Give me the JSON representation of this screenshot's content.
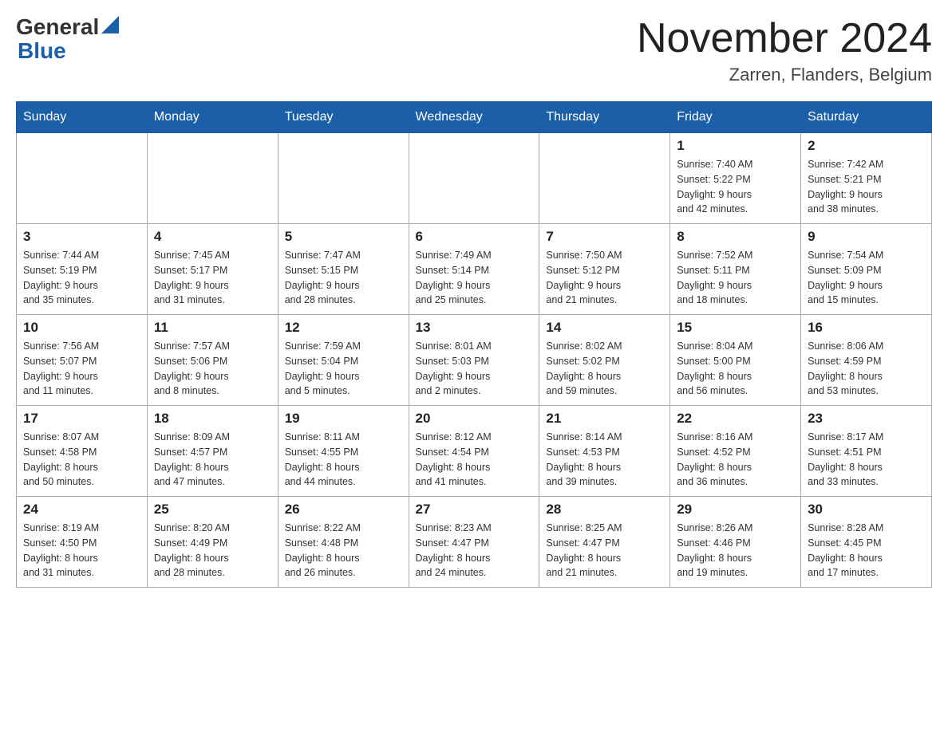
{
  "header": {
    "logo_line1": "General",
    "logo_line2": "Blue",
    "month_title": "November 2024",
    "location": "Zarren, Flanders, Belgium"
  },
  "calendar": {
    "days_of_week": [
      "Sunday",
      "Monday",
      "Tuesday",
      "Wednesday",
      "Thursday",
      "Friday",
      "Saturday"
    ],
    "weeks": [
      [
        {
          "day": "",
          "info": ""
        },
        {
          "day": "",
          "info": ""
        },
        {
          "day": "",
          "info": ""
        },
        {
          "day": "",
          "info": ""
        },
        {
          "day": "",
          "info": ""
        },
        {
          "day": "1",
          "info": "Sunrise: 7:40 AM\nSunset: 5:22 PM\nDaylight: 9 hours\nand 42 minutes."
        },
        {
          "day": "2",
          "info": "Sunrise: 7:42 AM\nSunset: 5:21 PM\nDaylight: 9 hours\nand 38 minutes."
        }
      ],
      [
        {
          "day": "3",
          "info": "Sunrise: 7:44 AM\nSunset: 5:19 PM\nDaylight: 9 hours\nand 35 minutes."
        },
        {
          "day": "4",
          "info": "Sunrise: 7:45 AM\nSunset: 5:17 PM\nDaylight: 9 hours\nand 31 minutes."
        },
        {
          "day": "5",
          "info": "Sunrise: 7:47 AM\nSunset: 5:15 PM\nDaylight: 9 hours\nand 28 minutes."
        },
        {
          "day": "6",
          "info": "Sunrise: 7:49 AM\nSunset: 5:14 PM\nDaylight: 9 hours\nand 25 minutes."
        },
        {
          "day": "7",
          "info": "Sunrise: 7:50 AM\nSunset: 5:12 PM\nDaylight: 9 hours\nand 21 minutes."
        },
        {
          "day": "8",
          "info": "Sunrise: 7:52 AM\nSunset: 5:11 PM\nDaylight: 9 hours\nand 18 minutes."
        },
        {
          "day": "9",
          "info": "Sunrise: 7:54 AM\nSunset: 5:09 PM\nDaylight: 9 hours\nand 15 minutes."
        }
      ],
      [
        {
          "day": "10",
          "info": "Sunrise: 7:56 AM\nSunset: 5:07 PM\nDaylight: 9 hours\nand 11 minutes."
        },
        {
          "day": "11",
          "info": "Sunrise: 7:57 AM\nSunset: 5:06 PM\nDaylight: 9 hours\nand 8 minutes."
        },
        {
          "day": "12",
          "info": "Sunrise: 7:59 AM\nSunset: 5:04 PM\nDaylight: 9 hours\nand 5 minutes."
        },
        {
          "day": "13",
          "info": "Sunrise: 8:01 AM\nSunset: 5:03 PM\nDaylight: 9 hours\nand 2 minutes."
        },
        {
          "day": "14",
          "info": "Sunrise: 8:02 AM\nSunset: 5:02 PM\nDaylight: 8 hours\nand 59 minutes."
        },
        {
          "day": "15",
          "info": "Sunrise: 8:04 AM\nSunset: 5:00 PM\nDaylight: 8 hours\nand 56 minutes."
        },
        {
          "day": "16",
          "info": "Sunrise: 8:06 AM\nSunset: 4:59 PM\nDaylight: 8 hours\nand 53 minutes."
        }
      ],
      [
        {
          "day": "17",
          "info": "Sunrise: 8:07 AM\nSunset: 4:58 PM\nDaylight: 8 hours\nand 50 minutes."
        },
        {
          "day": "18",
          "info": "Sunrise: 8:09 AM\nSunset: 4:57 PM\nDaylight: 8 hours\nand 47 minutes."
        },
        {
          "day": "19",
          "info": "Sunrise: 8:11 AM\nSunset: 4:55 PM\nDaylight: 8 hours\nand 44 minutes."
        },
        {
          "day": "20",
          "info": "Sunrise: 8:12 AM\nSunset: 4:54 PM\nDaylight: 8 hours\nand 41 minutes."
        },
        {
          "day": "21",
          "info": "Sunrise: 8:14 AM\nSunset: 4:53 PM\nDaylight: 8 hours\nand 39 minutes."
        },
        {
          "day": "22",
          "info": "Sunrise: 8:16 AM\nSunset: 4:52 PM\nDaylight: 8 hours\nand 36 minutes."
        },
        {
          "day": "23",
          "info": "Sunrise: 8:17 AM\nSunset: 4:51 PM\nDaylight: 8 hours\nand 33 minutes."
        }
      ],
      [
        {
          "day": "24",
          "info": "Sunrise: 8:19 AM\nSunset: 4:50 PM\nDaylight: 8 hours\nand 31 minutes."
        },
        {
          "day": "25",
          "info": "Sunrise: 8:20 AM\nSunset: 4:49 PM\nDaylight: 8 hours\nand 28 minutes."
        },
        {
          "day": "26",
          "info": "Sunrise: 8:22 AM\nSunset: 4:48 PM\nDaylight: 8 hours\nand 26 minutes."
        },
        {
          "day": "27",
          "info": "Sunrise: 8:23 AM\nSunset: 4:47 PM\nDaylight: 8 hours\nand 24 minutes."
        },
        {
          "day": "28",
          "info": "Sunrise: 8:25 AM\nSunset: 4:47 PM\nDaylight: 8 hours\nand 21 minutes."
        },
        {
          "day": "29",
          "info": "Sunrise: 8:26 AM\nSunset: 4:46 PM\nDaylight: 8 hours\nand 19 minutes."
        },
        {
          "day": "30",
          "info": "Sunrise: 8:28 AM\nSunset: 4:45 PM\nDaylight: 8 hours\nand 17 minutes."
        }
      ]
    ]
  }
}
